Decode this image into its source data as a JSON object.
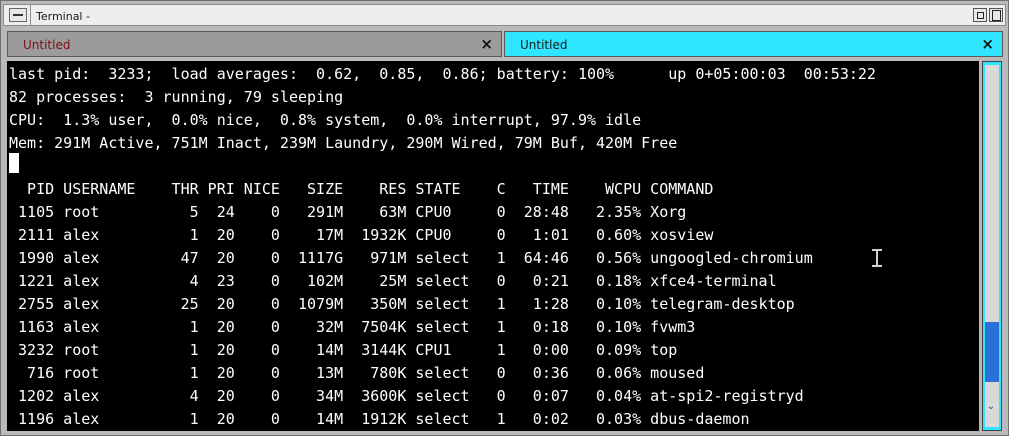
{
  "window": {
    "title": "Terminal -"
  },
  "tabs": [
    {
      "label": "Untitled",
      "active": false
    },
    {
      "label": "Untitled",
      "active": true
    }
  ],
  "tab_close_glyph": "×",
  "terminal": {
    "lines": [
      "last pid:  3233;  load averages:  0.62,  0.85,  0.86; battery: 100%      up 0+05:00:03  00:53:22",
      "82 processes:  3 running, 79 sleeping",
      "CPU:  1.3% user,  0.0% nice,  0.8% system,  0.0% interrupt, 97.9% idle",
      "Mem: 291M Active, 751M Inact, 239M Laundry, 290M Wired, 79M Buf, 420M Free",
      "",
      "  PID USERNAME    THR PRI NICE   SIZE    RES STATE    C   TIME    WCPU COMMAND",
      " 1105 root          5  24    0   291M    63M CPU0     0  28:48   2.35% Xorg",
      " 2111 alex          1  20    0    17M  1932K CPU0     0   1:01   0.60% xosview",
      " 1990 alex         47  20    0  1117G   971M select   1  64:46   0.56% ungoogled-chromium",
      " 1221 alex          4  23    0   102M    25M select   0   0:21   0.18% xfce4-terminal",
      " 2755 alex         25  20    0  1079M   350M select   1   1:28   0.10% telegram-desktop",
      " 1163 alex          1  20    0    32M  7504K select   1   0:18   0.10% fvwm3",
      " 3232 root          1  20    0    14M  3144K CPU1     1   0:00   0.09% top",
      "  716 root          1  20    0    13M   780K select   0   0:36   0.06% moused",
      " 1202 alex          4  20    0    34M  3600K select   0   0:07   0.04% at-spi2-registryd",
      " 1196 alex          1  20    0    14M  1912K select   1   0:02   0.03% dbus-daemon"
    ]
  },
  "scrollbar": {
    "position_fraction": 0.85
  },
  "colors": {
    "active_tab": "#2ee6ff",
    "inactive_tab": "#9b9b9b",
    "inactive_tab_text": "#7a1010",
    "terminal_bg": "#000000",
    "terminal_fg": "#ffffff",
    "scroll_thumb": "#2a6fd6"
  }
}
